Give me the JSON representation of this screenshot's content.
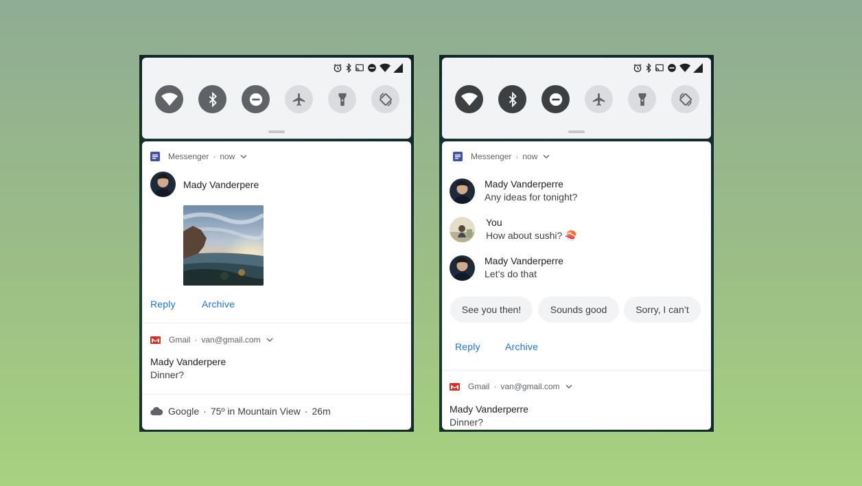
{
  "left": {
    "messenger": {
      "app": "Messenger",
      "time": "now",
      "sender": "Mady Vanderpere",
      "reply": "Reply",
      "archive": "Archive"
    },
    "gmail": {
      "app": "Gmail",
      "account": "van@gmail.com",
      "sender": "Mady Vanderpere",
      "subject": "Dinner?"
    },
    "google": {
      "app": "Google",
      "weather": "75º in Mountain View",
      "age": "26m"
    }
  },
  "right": {
    "messenger": {
      "app": "Messenger",
      "time": "now",
      "messages": [
        {
          "sender": "Mady Vanderperre",
          "text": "Any ideas for tonight?"
        },
        {
          "sender": "You",
          "text": "How about sushi? 🍣"
        },
        {
          "sender": "Mady Vanderperre",
          "text": "Let’s do that"
        }
      ],
      "smart_replies": [
        "See you then!",
        "Sounds good",
        "Sorry, I can’t"
      ],
      "reply": "Reply",
      "archive": "Archive"
    },
    "gmail": {
      "app": "Gmail",
      "account": "van@gmail.com",
      "sender": "Mady Vanderperre",
      "subject": "Dinner?"
    }
  },
  "separator": "·",
  "colors": {
    "accent": "#1a73e8",
    "messenger_icon": "#3f51b5",
    "gmail_icon": "#d93025"
  },
  "icons": {
    "status": [
      "alarm-icon",
      "bluetooth-icon",
      "cast-icon",
      "dnd-icon",
      "wifi-icon",
      "signal-icon"
    ],
    "tiles": [
      "wifi-icon",
      "bluetooth-icon",
      "dnd-icon",
      "airplane-icon",
      "flashlight-icon",
      "auto-rotate-icon"
    ]
  }
}
